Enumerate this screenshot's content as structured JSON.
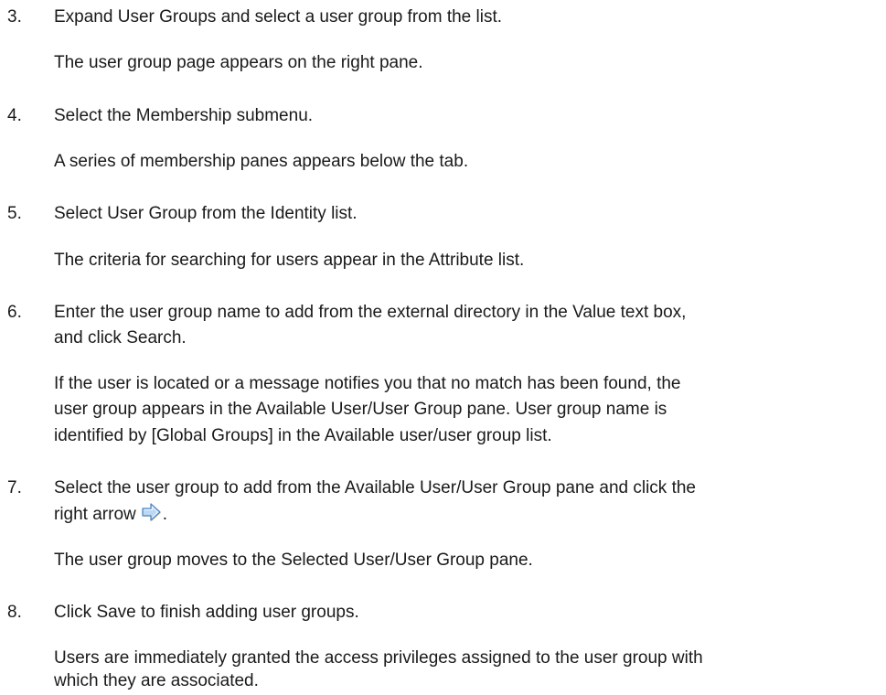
{
  "steps": [
    {
      "number": "3.",
      "text": "Expand User Groups and select a user group from the list.",
      "result": "The user group page appears on the right pane."
    },
    {
      "number": "4.",
      "text": "Select the Membership submenu.",
      "result": "A series of membership panes appears below the tab."
    },
    {
      "number": "5.",
      "text": "Select User Group from the Identity list.",
      "result": "The criteria for searching for users appear in the Attribute list."
    },
    {
      "number": "6.",
      "text_line1": "Enter the user group name to add from the external directory in the Value text box,",
      "text_line2": "and click Search.",
      "result_line1": "If the user is located or a message notifies you that no match has been found, the",
      "result_line2": "user group appears in the Available User/User Group pane. User group name is",
      "result_line3": "identified by [Global Groups] in the Available user/user group list."
    },
    {
      "number": "7.",
      "text_line1": "Select the user group to add from the Available User/User Group pane and click the",
      "text_line2": "right arrow",
      "text_line2_after": ".",
      "icon": "right-arrow-icon",
      "result": "The user group moves to the Selected User/User Group pane."
    },
    {
      "number": "8.",
      "text": "Click Save to finish adding user groups.",
      "result_line1": "Users are immediately granted the access privileges assigned to the user group with",
      "result_line2": "which they are associated."
    }
  ],
  "colors": {
    "text": "#1a1a1a",
    "arrow_fill": "#bcd8f5",
    "arrow_stroke": "#4d87c7",
    "arrow_shadow": "#f1c232"
  }
}
